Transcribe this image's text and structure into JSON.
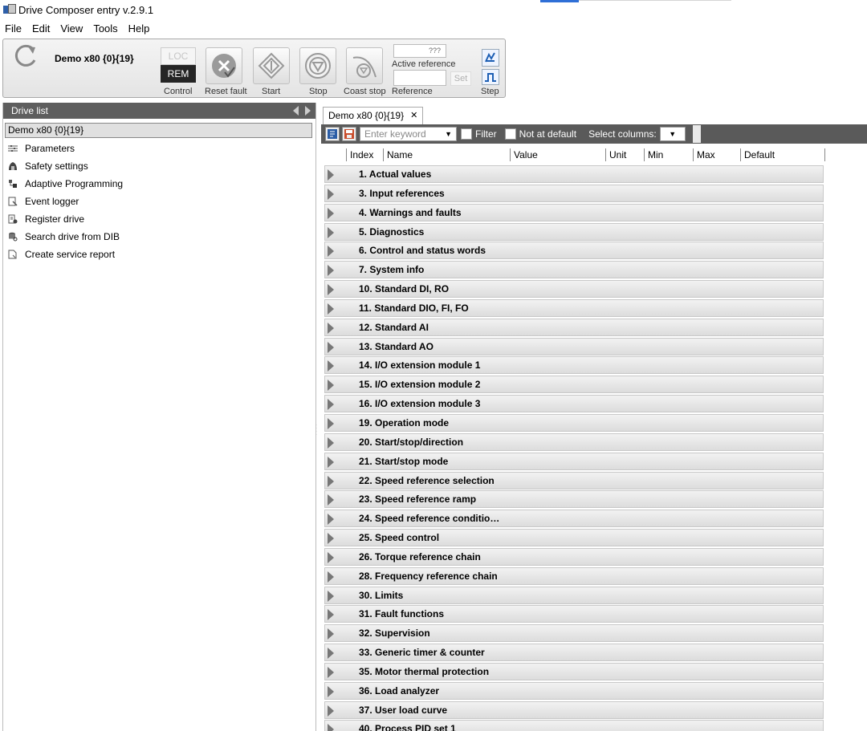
{
  "window": {
    "title": "Drive Composer entry v.2.9.1"
  },
  "menu": [
    "File",
    "Edit",
    "View",
    "Tools",
    "Help"
  ],
  "toolbar": {
    "drive_name": "Demo x80 {0}{19}",
    "loc_label": "LOC",
    "rem_label": "REM",
    "control_label": "Control",
    "reset_fault_label": "Reset fault",
    "start_label": "Start",
    "stop_label": "Stop",
    "coast_stop_label": "Coast stop",
    "active_reference_value": "???",
    "active_reference_label": "Active reference",
    "set_label": "Set",
    "reference_label": "Reference",
    "step_label": "Step"
  },
  "drive_list": {
    "header": "Drive list",
    "selected_drive": "Demo x80 {0}{19}",
    "items": [
      {
        "label": "Parameters",
        "icon": "sliders-icon"
      },
      {
        "label": "Safety settings",
        "icon": "safety-icon"
      },
      {
        "label": "Adaptive Programming",
        "icon": "program-icon"
      },
      {
        "label": "Event logger",
        "icon": "event-icon"
      },
      {
        "label": "Register drive",
        "icon": "register-icon"
      },
      {
        "label": "Search drive from DIB",
        "icon": "database-icon"
      },
      {
        "label": "Create service report",
        "icon": "report-icon"
      }
    ]
  },
  "parameters_tab": {
    "tab_label": "Demo x80 {0}{19}",
    "close_glyph": "✕",
    "search_placeholder": "Enter keyword",
    "filter_label": "Filter",
    "not_at_default_label": "Not at default",
    "select_columns_label": "Select columns:",
    "columns": [
      "Index",
      "Name",
      "Value",
      "Unit",
      "Min",
      "Max",
      "Default"
    ],
    "groups": [
      "1. Actual values",
      "3. Input references",
      "4. Warnings and faults",
      "5. Diagnostics",
      "6. Control and status words",
      "7. System info",
      "10. Standard DI, RO",
      "11. Standard DIO, FI, FO",
      "12. Standard AI",
      "13. Standard AO",
      "14. I/O extension module 1",
      "15. I/O extension module 2",
      "16. I/O extension module 3",
      "19. Operation mode",
      "20. Start/stop/direction",
      "21. Start/stop mode",
      "22. Speed reference selection",
      "23. Speed reference ramp",
      "24. Speed reference conditio…",
      "25. Speed control",
      "26. Torque reference chain",
      "28. Frequency reference chain",
      "30. Limits",
      "31. Fault functions",
      "32. Supervision",
      "33. Generic timer & counter",
      "35. Motor thermal protection",
      "36. Load analyzer",
      "37. User load curve",
      "40. Process PID set 1"
    ]
  }
}
